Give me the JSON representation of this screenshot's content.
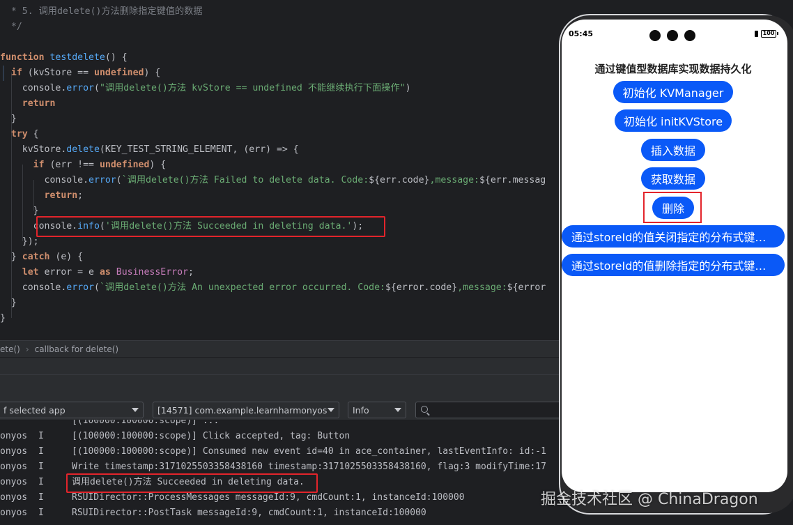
{
  "editor": {
    "lines": [
      [
        {
          "c": "t-cm",
          "t": "  * 5. 调用delete()方法删除指定键值的数据"
        }
      ],
      [
        {
          "c": "t-cm",
          "t": "  */"
        }
      ],
      [
        {
          "c": "t-pl",
          "t": ""
        }
      ],
      [
        {
          "c": "t-kw",
          "t": "function "
        },
        {
          "c": "t-fn",
          "t": "testdelete"
        },
        {
          "c": "t-pl",
          "t": "() {"
        }
      ],
      [
        {
          "c": "t-pl",
          "t": "  "
        },
        {
          "c": "t-kw",
          "t": "if"
        },
        {
          "c": "t-pl",
          "t": " (kvStore == "
        },
        {
          "c": "t-kw",
          "t": "undefined"
        },
        {
          "c": "t-pl",
          "t": ") {"
        }
      ],
      [
        {
          "c": "t-pl",
          "t": "    console."
        },
        {
          "c": "t-fn",
          "t": "error"
        },
        {
          "c": "t-pl",
          "t": "("
        },
        {
          "c": "t-str",
          "t": "\"调用delete()方法 kvStore == undefined 不能继续执行下面操作\""
        },
        {
          "c": "t-pl",
          "t": ")"
        }
      ],
      [
        {
          "c": "t-pl",
          "t": "    "
        },
        {
          "c": "t-kw",
          "t": "return"
        }
      ],
      [
        {
          "c": "t-pl",
          "t": "  }"
        }
      ],
      [
        {
          "c": "t-pl",
          "t": "  "
        },
        {
          "c": "t-kw",
          "t": "try"
        },
        {
          "c": "t-pl",
          "t": " {"
        }
      ],
      [
        {
          "c": "t-pl",
          "t": "    kvStore."
        },
        {
          "c": "t-fn",
          "t": "delete"
        },
        {
          "c": "t-pl",
          "t": "(KEY_TEST_STRING_ELEMENT, (err) => {"
        }
      ],
      [
        {
          "c": "t-pl",
          "t": "      "
        },
        {
          "c": "t-kw",
          "t": "if"
        },
        {
          "c": "t-pl",
          "t": " (err !== "
        },
        {
          "c": "t-kw",
          "t": "undefined"
        },
        {
          "c": "t-pl",
          "t": ") {"
        }
      ],
      [
        {
          "c": "t-pl",
          "t": "        console."
        },
        {
          "c": "t-fn",
          "t": "error"
        },
        {
          "c": "t-pl",
          "t": "("
        },
        {
          "c": "t-str",
          "t": "`调用delete()方法 Failed to delete data. Code:"
        },
        {
          "c": "t-pl",
          "t": "${err.code}"
        },
        {
          "c": "t-str",
          "t": ",message:"
        },
        {
          "c": "t-pl",
          "t": "${err.messag"
        }
      ],
      [
        {
          "c": "t-pl",
          "t": "        "
        },
        {
          "c": "t-kw",
          "t": "return"
        },
        {
          "c": "t-pl",
          "t": ";"
        }
      ],
      [
        {
          "c": "t-pl",
          "t": "      }"
        }
      ],
      [
        {
          "c": "t-pl",
          "t": "      console."
        },
        {
          "c": "t-fn",
          "t": "info"
        },
        {
          "c": "t-pl",
          "t": "("
        },
        {
          "c": "t-str",
          "t": "'调用delete()方法 Succeeded in deleting data.'"
        },
        {
          "c": "t-pl",
          "t": ");"
        }
      ],
      [
        {
          "c": "t-pl",
          "t": "    });"
        }
      ],
      [
        {
          "c": "t-pl",
          "t": "  } "
        },
        {
          "c": "t-kw",
          "t": "catch"
        },
        {
          "c": "t-pl",
          "t": " (e) {"
        }
      ],
      [
        {
          "c": "t-pl",
          "t": "    "
        },
        {
          "c": "t-kw",
          "t": "let"
        },
        {
          "c": "t-pl",
          "t": " error = e "
        },
        {
          "c": "t-kw",
          "t": "as"
        },
        {
          "c": "t-pl",
          "t": " "
        },
        {
          "c": "t-type",
          "t": "BusinessError"
        },
        {
          "c": "t-pl",
          "t": ";"
        }
      ],
      [
        {
          "c": "t-pl",
          "t": "    console."
        },
        {
          "c": "t-fn",
          "t": "error"
        },
        {
          "c": "t-pl",
          "t": "("
        },
        {
          "c": "t-str",
          "t": "`调用delete()方法 An unexpected error occurred. Code:"
        },
        {
          "c": "t-pl",
          "t": "${error.code}"
        },
        {
          "c": "t-str",
          "t": ",message:"
        },
        {
          "c": "t-pl",
          "t": "${error"
        }
      ],
      [
        {
          "c": "t-pl",
          "t": "  }"
        }
      ],
      [
        {
          "c": "t-pl",
          "t": "}"
        }
      ]
    ]
  },
  "breadcrumb": {
    "items": [
      "ete()",
      "callback for delete()"
    ]
  },
  "log_toolbar": {
    "app_filter": "f selected app",
    "process": "[14571] com.example.learnharmonyos",
    "level": "Info",
    "search_placeholder": ""
  },
  "log": {
    "lines": [
      {
        "tag": "",
        "lvl": "",
        "msg": "[(100000:100000:scope)] ..."
      },
      {
        "tag": "onyos",
        "lvl": "I",
        "msg": "[(100000:100000:scope)] Click accepted, tag: Button"
      },
      {
        "tag": "onyos",
        "lvl": "I",
        "msg": "[(100000:100000:scope)] Consumed new event id=40 in ace_container, lastEventInfo: id:-1"
      },
      {
        "tag": "onyos",
        "lvl": "I",
        "msg": "Write timestamp:3171025503358438160 timestamp:3171025503358438160, flag:3 modifyTime:17"
      },
      {
        "tag": "onyos",
        "lvl": "I",
        "msg": "调用delete()方法 Succeeded in deleting data."
      },
      {
        "tag": "onyos",
        "lvl": "I",
        "msg": "RSUIDirector::ProcessMessages messageId:9, cmdCount:1, instanceId:100000"
      },
      {
        "tag": "onyos",
        "lvl": "I",
        "msg": "RSUIDirector::PostTask messageId:9, cmdCount:1, instanceId:100000"
      }
    ]
  },
  "phone": {
    "time": "05:45",
    "battery": "100",
    "title": "通过键值型数据库实现数据持久化",
    "buttons": [
      "初始化 KVManager",
      "初始化 initKVStore",
      "插入数据",
      "获取数据",
      "删除",
      "通过storeId的值关闭指定的分布式键…",
      "通过storeId的值删除指定的分布式键…"
    ],
    "accent": "#0a59f7"
  },
  "watermark": "掘金技术社区 @ ChinaDragon"
}
